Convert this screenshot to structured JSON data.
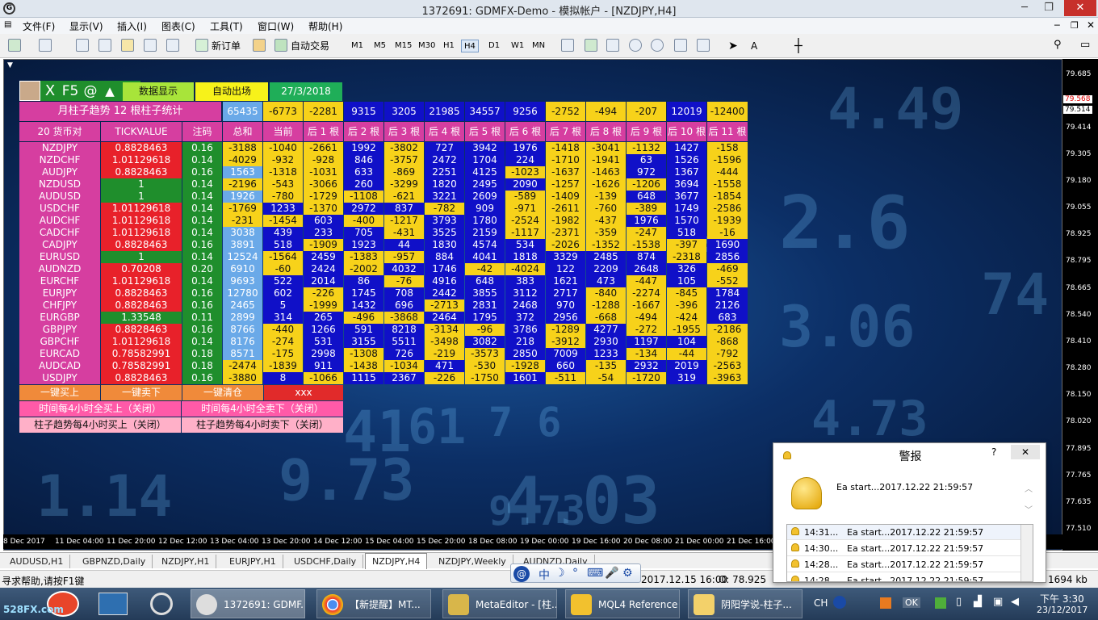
{
  "window": {
    "title": "1372691: GDMFX-Demo - 模拟帐户 - [NZDJPY,H4]",
    "min": "─",
    "max": "❐",
    "close": "✕"
  },
  "menu": [
    "文件(F)",
    "显示(V)",
    "插入(I)",
    "图表(C)",
    "工具(T)",
    "窗口(W)",
    "帮助(H)"
  ],
  "toolbar": {
    "new_order": "新订单",
    "auto_trade": "自动交易",
    "timeframes": [
      "M1",
      "M5",
      "M15",
      "M30",
      "H1",
      "H4",
      "D1",
      "W1",
      "MN"
    ],
    "selected_tf": "H4",
    "text_tool": "A"
  },
  "price_axis": [
    "79.685",
    "79.568",
    "79.514",
    "79.414",
    "79.305",
    "79.180",
    "79.055",
    "78.925",
    "78.795",
    "78.665",
    "78.540",
    "78.410",
    "78.280",
    "78.150",
    "78.020",
    "77.895",
    "77.765",
    "77.635",
    "77.510"
  ],
  "time_axis": [
    "8 Dec 2017",
    "11 Dec 04:00",
    "11 Dec 20:00",
    "12 Dec 12:00",
    "13 Dec 04:00",
    "13 Dec 20:00",
    "14 Dec 12:00",
    "15 Dec 04:00",
    "15 Dec 20:00",
    "18 Dec 08:00",
    "19 Dec 00:00",
    "19 Dec 16:00",
    "20 Dec 08:00",
    "21 Dec 00:00",
    "21 Dec 16:00"
  ],
  "bg_numbers": [
    "4.49",
    "2.6",
    "3.06",
    "4.73",
    "41",
    "9.73",
    "4.03",
    "1.14",
    "74",
    "7 6",
    "61",
    "9.73",
    "54"
  ],
  "panel": {
    "top_buttons": [
      "X",
      "F5",
      "@",
      "▲"
    ],
    "tabs": [
      "数据显示",
      "自动出场",
      "27/3/2018"
    ],
    "stat_title": "月柱子趋势 12 根柱子统计",
    "stat_values": [
      "65435",
      "-6773",
      "-2281",
      "9315",
      "3205",
      "21985",
      "34557",
      "9256",
      "-2752",
      "-494",
      "-207",
      "12019",
      "-12400"
    ],
    "headers": [
      "20 货币对",
      "TICKVALUE",
      "注码",
      "总和",
      "当前",
      "后 1 根",
      "后 2 根",
      "后 3 根",
      "后 4 根",
      "后 5 根",
      "后 6 根",
      "后 7 根",
      "后 8 根",
      "后 9 根",
      "后 10 根",
      "后 11 根"
    ],
    "rows": [
      [
        "NZDJPY",
        "0.8828463",
        "0.16",
        "-3188",
        "-1040",
        "-2661",
        "1992",
        "-3802",
        "727",
        "3942",
        "1976",
        "-1418",
        "-3041",
        "-1132",
        "1427",
        "-158"
      ],
      [
        "NZDCHF",
        "1.01129618",
        "0.14",
        "-4029",
        "-932",
        "-928",
        "846",
        "-3757",
        "2472",
        "1704",
        "224",
        "-1710",
        "-1941",
        "63",
        "1526",
        "-1596"
      ],
      [
        "AUDJPY",
        "0.8828463",
        "0.16",
        "1563",
        "-1318",
        "-1031",
        "633",
        "-869",
        "2251",
        "4125",
        "-1023",
        "-1637",
        "-1463",
        "972",
        "1367",
        "-444"
      ],
      [
        "NZDUSD",
        "1",
        "0.14",
        "-2196",
        "-543",
        "-3066",
        "260",
        "-3299",
        "1820",
        "2495",
        "2090",
        "-1257",
        "-1626",
        "-1206",
        "3694",
        "-1558"
      ],
      [
        "AUDUSD",
        "1",
        "0.14",
        "1926",
        "-780",
        "-1729",
        "-1108",
        "-621",
        "3221",
        "2609",
        "-589",
        "-1409",
        "-139",
        "648",
        "3677",
        "-1854"
      ],
      [
        "USDCHF",
        "1.01129618",
        "0.14",
        "-1769",
        "1233",
        "-1370",
        "2972",
        "837",
        "-782",
        "909",
        "-971",
        "-2611",
        "-760",
        "-389",
        "1749",
        "-2586"
      ],
      [
        "AUDCHF",
        "1.01129618",
        "0.14",
        "-231",
        "-1454",
        "603",
        "-400",
        "-1217",
        "3793",
        "1780",
        "-2524",
        "-1982",
        "-437",
        "1976",
        "1570",
        "-1939"
      ],
      [
        "CADCHF",
        "1.01129618",
        "0.14",
        "3038",
        "439",
        "233",
        "705",
        "-431",
        "3525",
        "2159",
        "-1117",
        "-2371",
        "-359",
        "-247",
        "518",
        "-16"
      ],
      [
        "CADJPY",
        "0.8828463",
        "0.16",
        "3891",
        "518",
        "-1909",
        "1923",
        "44",
        "1830",
        "4574",
        "534",
        "-2026",
        "-1352",
        "-1538",
        "-397",
        "1690"
      ],
      [
        "EURUSD",
        "1",
        "0.14",
        "12524",
        "-1564",
        "2459",
        "-1383",
        "-957",
        "884",
        "4041",
        "1818",
        "3329",
        "2485",
        "874",
        "-2318",
        "2856"
      ],
      [
        "AUDNZD",
        "0.70208",
        "0.20",
        "6910",
        "-60",
        "2424",
        "-2002",
        "4032",
        "1746",
        "-42",
        "-4024",
        "122",
        "2209",
        "2648",
        "326",
        "-469"
      ],
      [
        "EURCHF",
        "1.01129618",
        "0.14",
        "9693",
        "522",
        "2014",
        "86",
        "-76",
        "4916",
        "648",
        "383",
        "1621",
        "473",
        "-447",
        "105",
        "-552"
      ],
      [
        "EURJPY",
        "0.8828463",
        "0.16",
        "12780",
        "602",
        "-226",
        "1745",
        "708",
        "2442",
        "3855",
        "3112",
        "2717",
        "-840",
        "-2274",
        "-845",
        "1784"
      ],
      [
        "CHFJPY",
        "0.8828463",
        "0.16",
        "2465",
        "5",
        "-1999",
        "1432",
        "696",
        "-2713",
        "2831",
        "2468",
        "970",
        "-1288",
        "-1667",
        "-396",
        "2126"
      ],
      [
        "EURGBP",
        "1.33548",
        "0.11",
        "2899",
        "314",
        "265",
        "-496",
        "-3868",
        "2464",
        "1795",
        "372",
        "2956",
        "-668",
        "-494",
        "-424",
        "683"
      ],
      [
        "GBPJPY",
        "0.8828463",
        "0.16",
        "8766",
        "-440",
        "1266",
        "591",
        "8218",
        "-3134",
        "-96",
        "3786",
        "-1289",
        "4277",
        "-272",
        "-1955",
        "-2186"
      ],
      [
        "GBPCHF",
        "1.01129618",
        "0.14",
        "8176",
        "-274",
        "531",
        "3155",
        "5511",
        "-3498",
        "3082",
        "218",
        "-3912",
        "2930",
        "1197",
        "104",
        "-868"
      ],
      [
        "EURCAD",
        "0.78582991",
        "0.18",
        "8571",
        "-175",
        "2998",
        "-1308",
        "726",
        "-219",
        "-3573",
        "2850",
        "7009",
        "1233",
        "-134",
        "-44",
        "-792"
      ],
      [
        "AUDCAD",
        "0.78582991",
        "0.18",
        "-2474",
        "-1839",
        "911",
        "-1438",
        "-1034",
        "471",
        "-530",
        "-1928",
        "660",
        "-135",
        "2932",
        "2019",
        "-2563"
      ],
      [
        "USDJPY",
        "0.8828463",
        "0.16",
        "-3880",
        "8",
        "-1066",
        "1115",
        "2367",
        "-226",
        "-1750",
        "1601",
        "-511",
        "-54",
        "-1720",
        "319",
        "-3963"
      ]
    ],
    "buttons": {
      "buy_all": "一键买上",
      "sell_all": "一键卖下",
      "close_all": "一键清仓",
      "xxx": "xxx",
      "time_buy": "时间每4小时全买上（关闭）",
      "time_sell": "时间每4小时全卖下（关闭）",
      "trend_buy": "柱子趋势每4小时买上（关闭）",
      "trend_sell": "柱子趋势每4小时卖下（关闭）"
    }
  },
  "tabs": [
    "AUDUSD,H1",
    "GBPNZD,Daily",
    "NZDJPY,H1",
    "EURJPY,H1",
    "USDCHF,Daily",
    "NZDJPY,H4",
    "NZDJPY,Weekly",
    "AUDNZD,Daily"
  ],
  "active_tab": "NZDJPY,H4",
  "status": {
    "help": "寻求帮助,请按F1键",
    "date": "2017.12.15 16:00",
    "open": "O: 78.925",
    "size": "1694 kb"
  },
  "ime": [
    "中",
    "☽",
    "°",
    "⌨",
    "🎤",
    "⚙"
  ],
  "alert": {
    "title": "警报",
    "help": "?",
    "close": "✕",
    "message": "Ea start...2017.12.22 21:59:57",
    "rows": [
      [
        "14:31...",
        "Ea start...2017.12.22 21:59:57"
      ],
      [
        "14:30...",
        "Ea start...2017.12.22 21:59:57"
      ],
      [
        "14:28...",
        "Ea start...2017.12.22 21:59:57"
      ],
      [
        "14:28...",
        "Ea start...2017.12.22 21:59:57"
      ]
    ]
  },
  "taskbar": {
    "tasks": [
      "1372691: GDMF...",
      "【新提醒】MT...",
      "MetaEditor - [柱...",
      "MQL4 Reference",
      "阴阳学说-柱子..."
    ],
    "lang": "CH",
    "ok": "OK",
    "time": "下午 3:30",
    "date": "23/12/2017",
    "watermark": "528FX.com"
  }
}
